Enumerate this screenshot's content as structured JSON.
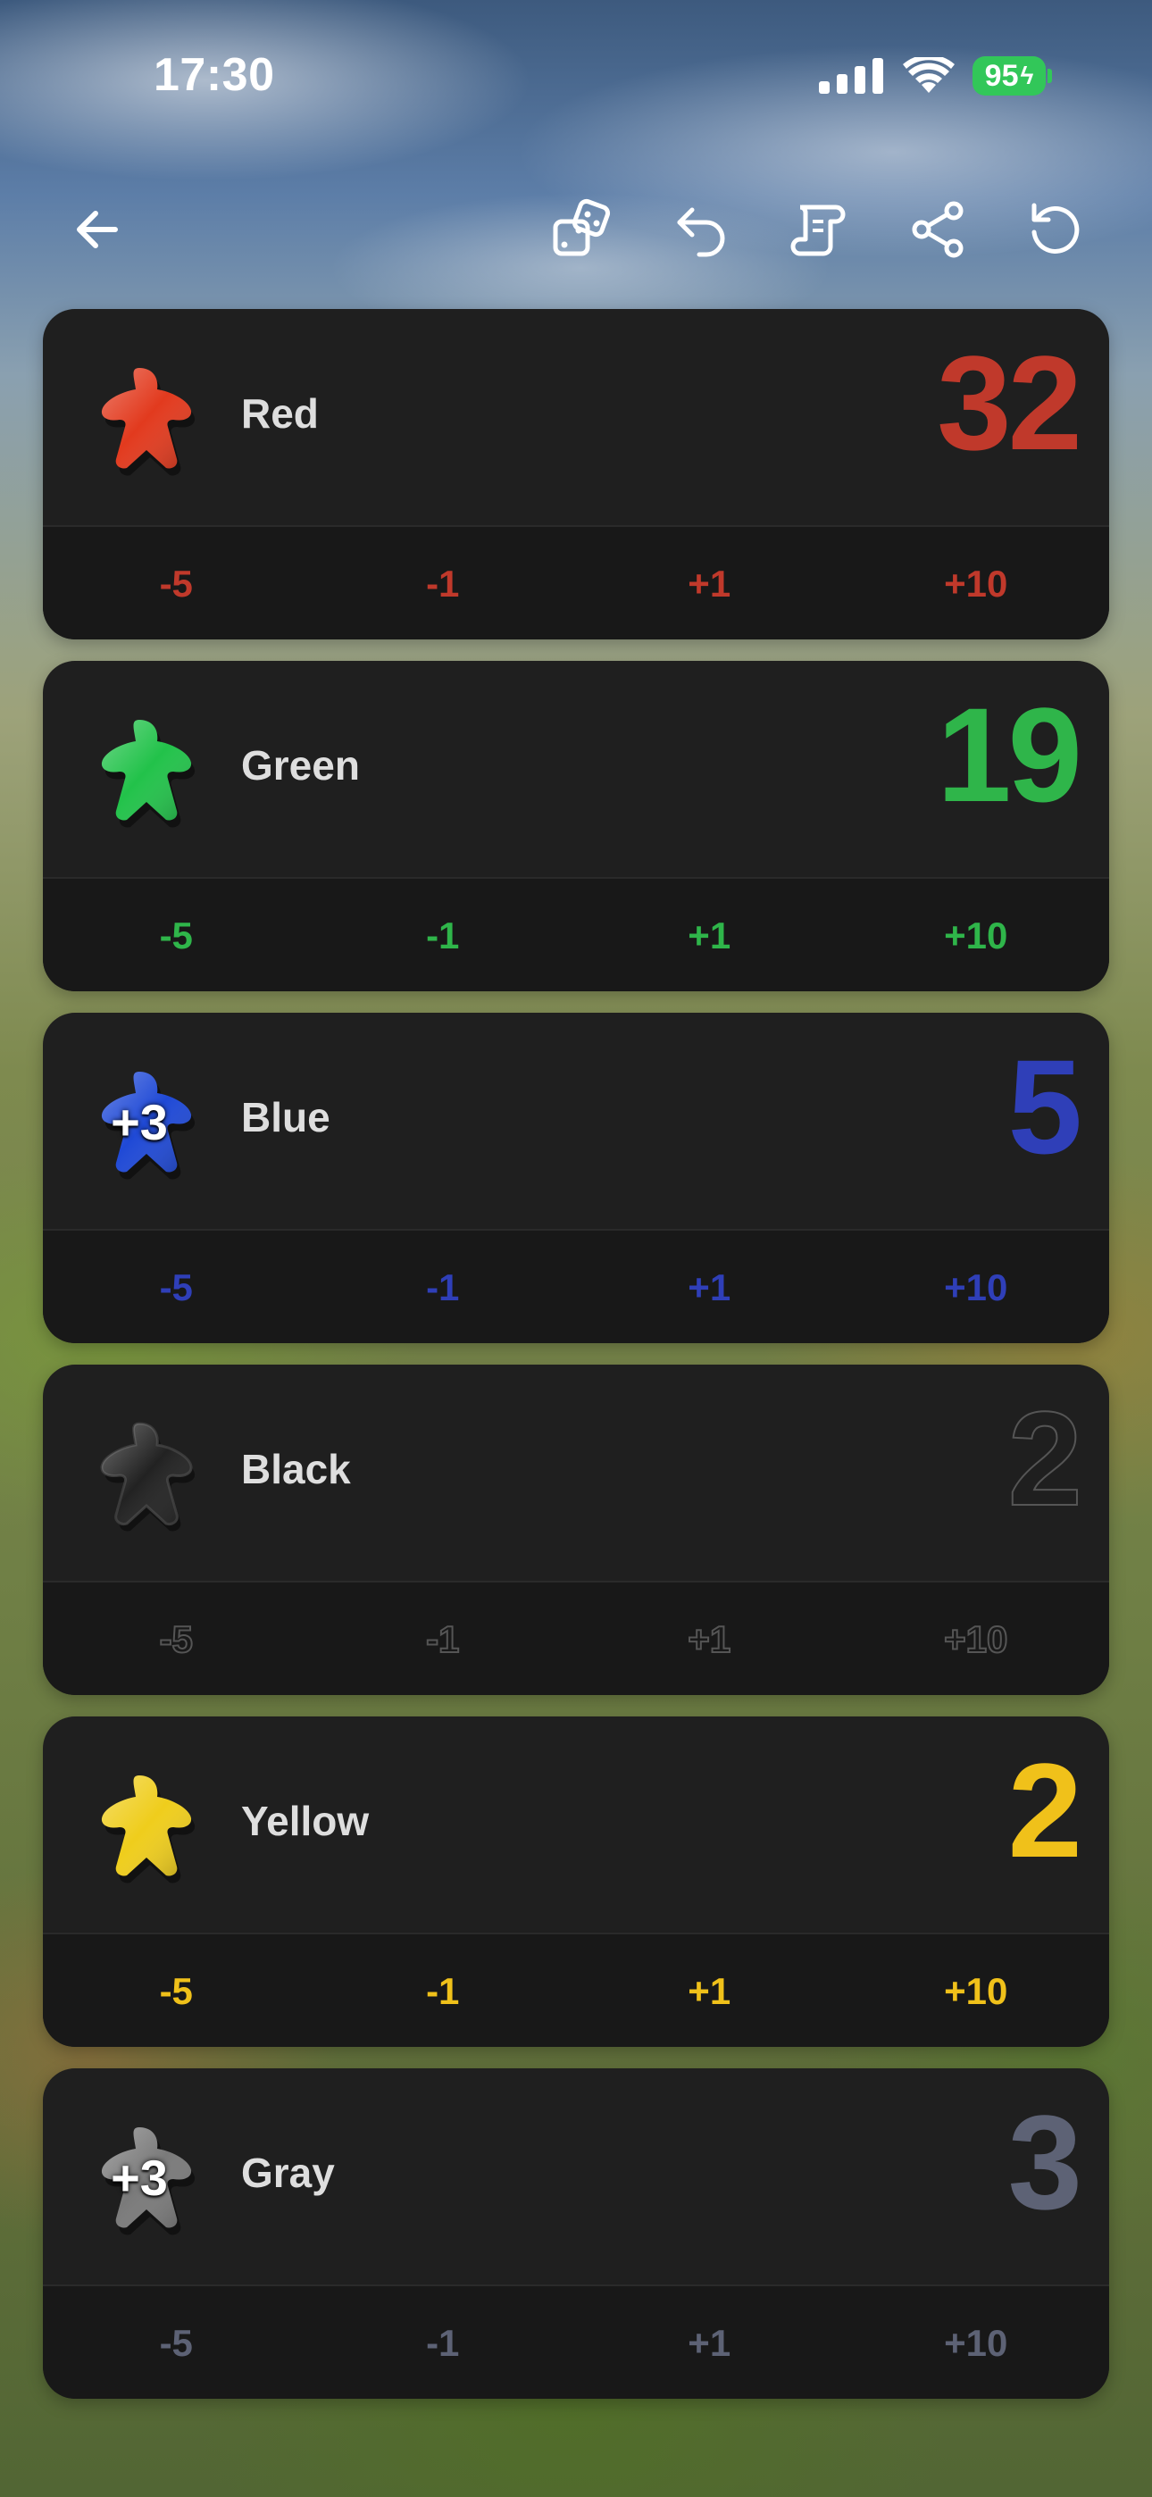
{
  "status_bar": {
    "time": "17:30",
    "battery": "95"
  },
  "toolbar": {
    "icons": [
      "back-arrow-icon",
      "dice-icon",
      "undo-icon",
      "scroll-icon",
      "share-icon",
      "reset-icon"
    ]
  },
  "players": [
    {
      "name": "Red",
      "score": "32",
      "color": "#c0392b",
      "meeple_color": "#e23a1e",
      "bonus": "",
      "adjust": [
        "-5",
        "-1",
        "+1",
        "+10"
      ]
    },
    {
      "name": "Green",
      "score": "19",
      "color": "#2fb54a",
      "meeple_color": "#22c24a",
      "bonus": "",
      "adjust": [
        "-5",
        "-1",
        "+1",
        "+10"
      ]
    },
    {
      "name": "Blue",
      "score": "5",
      "color": "#2f3fb8",
      "meeple_color": "#1f49d6",
      "bonus": "+3",
      "adjust": [
        "-5",
        "-1",
        "+1",
        "+10"
      ]
    },
    {
      "name": "Black",
      "score": "2",
      "color": "#2a2a2a",
      "meeple_color": "#222222",
      "bonus": "",
      "adjust": [
        "-5",
        "-1",
        "+1",
        "+10"
      ]
    },
    {
      "name": "Yellow",
      "score": "2",
      "color": "#f0c11a",
      "meeple_color": "#efcd1c",
      "bonus": "",
      "adjust": [
        "-5",
        "-1",
        "+1",
        "+10"
      ]
    },
    {
      "name": "Gray",
      "score": "3",
      "color": "#5d6275",
      "meeple_color": "#7a7a7a",
      "bonus": "+3",
      "adjust": [
        "-5",
        "-1",
        "+1",
        "+10"
      ]
    }
  ]
}
